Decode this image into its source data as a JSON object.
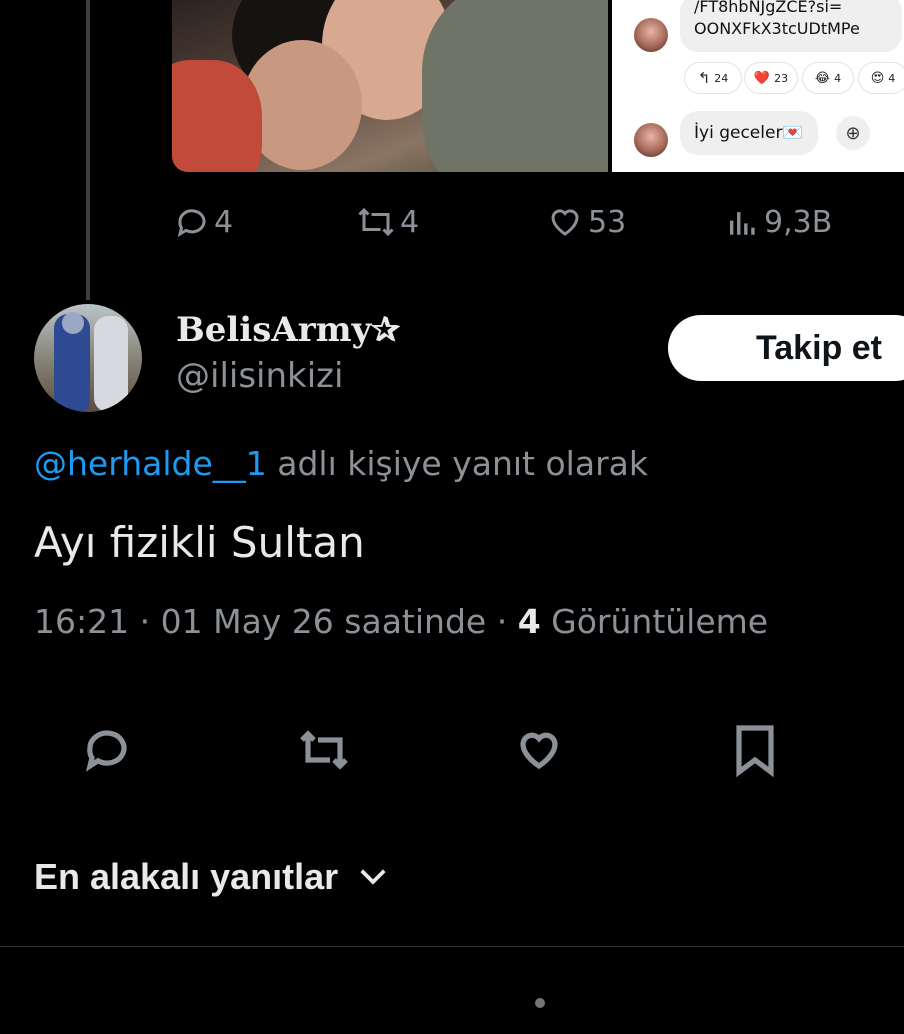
{
  "quoted_media": {
    "chat": {
      "link_lines": [
        "/FT8hbNJgZCE?si=",
        "OONXFkX3tcUDtMPe"
      ],
      "reactions": [
        {
          "icon": "reply-arrow-icon",
          "glyph": "↰",
          "count": "24"
        },
        {
          "icon": "red-heart-icon",
          "glyph": "❤️",
          "count": "23"
        },
        {
          "icon": "laughing-emoji-icon",
          "glyph": "😂",
          "count": "4"
        },
        {
          "icon": "heart-eyes-emoji-icon",
          "glyph": "😍",
          "count": "4"
        }
      ],
      "message": "İyi geceler💌",
      "action_icon": "add-reaction-icon"
    }
  },
  "prev_tweet_stats": {
    "replies": "4",
    "reposts": "4",
    "likes": "53",
    "views": "9,3B"
  },
  "reply_tweet": {
    "display_name": "BelisArmy✰",
    "handle": "@ilisinkizi",
    "follow_label": "Takip et",
    "reply_to_mention": "@herhalde__1",
    "reply_to_suffix": "adlı kişiye yanıt olarak",
    "text": "Ayı fizikli Sultan",
    "time": "16:21",
    "date_text": "01 May 26 saatinde",
    "view_count": "4",
    "view_label": "Görüntüleme",
    "separator": "·"
  },
  "actions": [
    "reply-icon",
    "repost-icon",
    "like-icon",
    "bookmark-icon"
  ],
  "replies_sort": {
    "label": "En alakalı yanıtlar"
  },
  "colors": {
    "background": "#000000",
    "text": "#e7e9ea",
    "muted": "#8b9196",
    "link": "#1d9bf0"
  }
}
